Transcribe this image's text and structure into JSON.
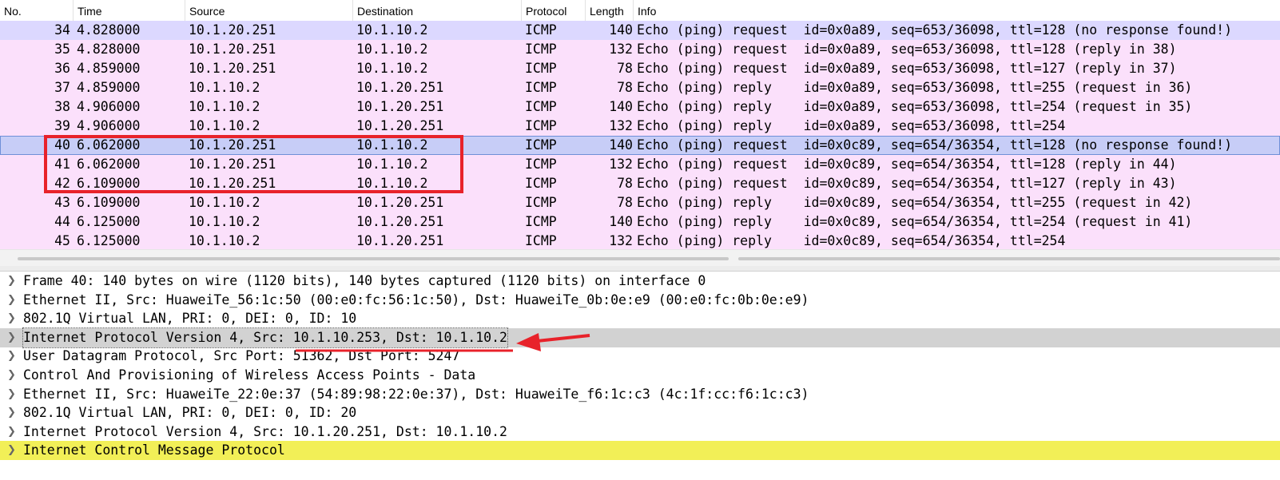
{
  "columns": [
    "No.",
    "Time",
    "Source",
    "Destination",
    "Protocol",
    "Length",
    "Info"
  ],
  "packets": [
    {
      "no": "34",
      "time": "4.828000",
      "src": "10.1.20.251",
      "dst": "10.1.10.2",
      "proto": "ICMP",
      "len": "140",
      "info": "Echo (ping) request  id=0x0a89, seq=653/36098, ttl=128 (no response found!)",
      "bg": "#dcd8ff"
    },
    {
      "no": "35",
      "time": "4.828000",
      "src": "10.1.20.251",
      "dst": "10.1.10.2",
      "proto": "ICMP",
      "len": "132",
      "info": "Echo (ping) request  id=0x0a89, seq=653/36098, ttl=128 (reply in 38)",
      "bg": "#fbe0fb"
    },
    {
      "no": "36",
      "time": "4.859000",
      "src": "10.1.20.251",
      "dst": "10.1.10.2",
      "proto": "ICMP",
      "len": "78",
      "info": "Echo (ping) request  id=0x0a89, seq=653/36098, ttl=127 (reply in 37)",
      "bg": "#fbe0fb"
    },
    {
      "no": "37",
      "time": "4.859000",
      "src": "10.1.10.2",
      "dst": "10.1.20.251",
      "proto": "ICMP",
      "len": "78",
      "info": "Echo (ping) reply    id=0x0a89, seq=653/36098, ttl=255 (request in 36)",
      "bg": "#fbe0fb"
    },
    {
      "no": "38",
      "time": "4.906000",
      "src": "10.1.10.2",
      "dst": "10.1.20.251",
      "proto": "ICMP",
      "len": "140",
      "info": "Echo (ping) reply    id=0x0a89, seq=653/36098, ttl=254 (request in 35)",
      "bg": "#fbe0fb"
    },
    {
      "no": "39",
      "time": "4.906000",
      "src": "10.1.10.2",
      "dst": "10.1.20.251",
      "proto": "ICMP",
      "len": "132",
      "info": "Echo (ping) reply    id=0x0a89, seq=653/36098, ttl=254",
      "bg": "#fbe0fb"
    },
    {
      "no": "40",
      "time": "6.062000",
      "src": "10.1.20.251",
      "dst": "10.1.10.2",
      "proto": "ICMP",
      "len": "140",
      "info": "Echo (ping) request  id=0x0c89, seq=654/36354, ttl=128 (no response found!)",
      "bg": "#c7cdf7",
      "selected": true
    },
    {
      "no": "41",
      "time": "6.062000",
      "src": "10.1.20.251",
      "dst": "10.1.10.2",
      "proto": "ICMP",
      "len": "132",
      "info": "Echo (ping) request  id=0x0c89, seq=654/36354, ttl=128 (reply in 44)",
      "bg": "#fbe0fb"
    },
    {
      "no": "42",
      "time": "6.109000",
      "src": "10.1.20.251",
      "dst": "10.1.10.2",
      "proto": "ICMP",
      "len": "78",
      "info": "Echo (ping) request  id=0x0c89, seq=654/36354, ttl=127 (reply in 43)",
      "bg": "#fbe0fb"
    },
    {
      "no": "43",
      "time": "6.109000",
      "src": "10.1.10.2",
      "dst": "10.1.20.251",
      "proto": "ICMP",
      "len": "78",
      "info": "Echo (ping) reply    id=0x0c89, seq=654/36354, ttl=255 (request in 42)",
      "bg": "#fbe0fb"
    },
    {
      "no": "44",
      "time": "6.125000",
      "src": "10.1.10.2",
      "dst": "10.1.20.251",
      "proto": "ICMP",
      "len": "140",
      "info": "Echo (ping) reply    id=0x0c89, seq=654/36354, ttl=254 (request in 41)",
      "bg": "#fbe0fb"
    },
    {
      "no": "45",
      "time": "6.125000",
      "src": "10.1.10.2",
      "dst": "10.1.20.251",
      "proto": "ICMP",
      "len": "132",
      "info": "Echo (ping) reply    id=0x0c89, seq=654/36354, ttl=254",
      "bg": "#fbe0fb"
    }
  ],
  "details": [
    {
      "text": "Frame 40: 140 bytes on wire (1120 bits), 140 bytes captured (1120 bits) on interface 0",
      "style": "normal"
    },
    {
      "text": "Ethernet II, Src: HuaweiTe_56:1c:50 (00:e0:fc:56:1c:50), Dst: HuaweiTe_0b:0e:e9 (00:e0:fc:0b:0e:e9)",
      "style": "normal"
    },
    {
      "text": "802.1Q Virtual LAN, PRI: 0, DEI: 0, ID: 10",
      "style": "normal"
    },
    {
      "text": "Internet Protocol Version 4, Src: 10.1.10.253, Dst: 10.1.10.2",
      "style": "selected"
    },
    {
      "text": "User Datagram Protocol, Src Port: 51362, Dst Port: 5247",
      "style": "normal"
    },
    {
      "text": "Control And Provisioning of Wireless Access Points - Data",
      "style": "normal"
    },
    {
      "text": "Ethernet II, Src: HuaweiTe_22:0e:37 (54:89:98:22:0e:37), Dst: HuaweiTe_f6:1c:c3 (4c:1f:cc:f6:1c:c3)",
      "style": "normal"
    },
    {
      "text": "802.1Q Virtual LAN, PRI: 0, DEI: 0, ID: 20",
      "style": "normal"
    },
    {
      "text": "Internet Protocol Version 4, Src: 10.1.20.251, Dst: 10.1.10.2",
      "style": "normal"
    },
    {
      "text": "Internet Control Message Protocol",
      "style": "highlight"
    }
  ],
  "icons": {
    "expand": "chevron-right-icon"
  },
  "colors": {
    "icmp_row": "#fbe0fb",
    "first_row": "#dcd8ff",
    "selected_row": "#c7cdf7",
    "detail_selected": "#d2d2d2",
    "detail_highlight": "#f2ef57",
    "annotation_red": "#e8222a"
  }
}
